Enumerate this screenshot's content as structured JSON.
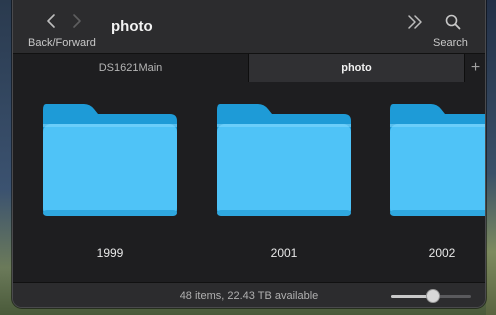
{
  "toolbar": {
    "nav_label": "Back/Forward",
    "back_icon": "chevron-left-icon",
    "forward_icon": "chevron-right-icon",
    "title": "photo",
    "more_icon": "double-chevron-right-icon",
    "search_icon": "magnifier-icon",
    "search_label": "Search"
  },
  "tabs": [
    {
      "label": "DS1621Main",
      "active": false
    },
    {
      "label": "photo",
      "active": true
    }
  ],
  "new_tab_label": "+",
  "folders": [
    {
      "name": "1999",
      "icon": "folder-icon"
    },
    {
      "name": "2001",
      "icon": "folder-icon"
    },
    {
      "name": "2002",
      "icon": "folder-icon"
    }
  ],
  "status": {
    "text": "48 items, 22.43 TB available",
    "icon_size_level": 0.52
  },
  "colors": {
    "folder_light": "#4fc3f7",
    "folder_dark": "#1e9bd7",
    "window_bg": "#1e1e20"
  }
}
